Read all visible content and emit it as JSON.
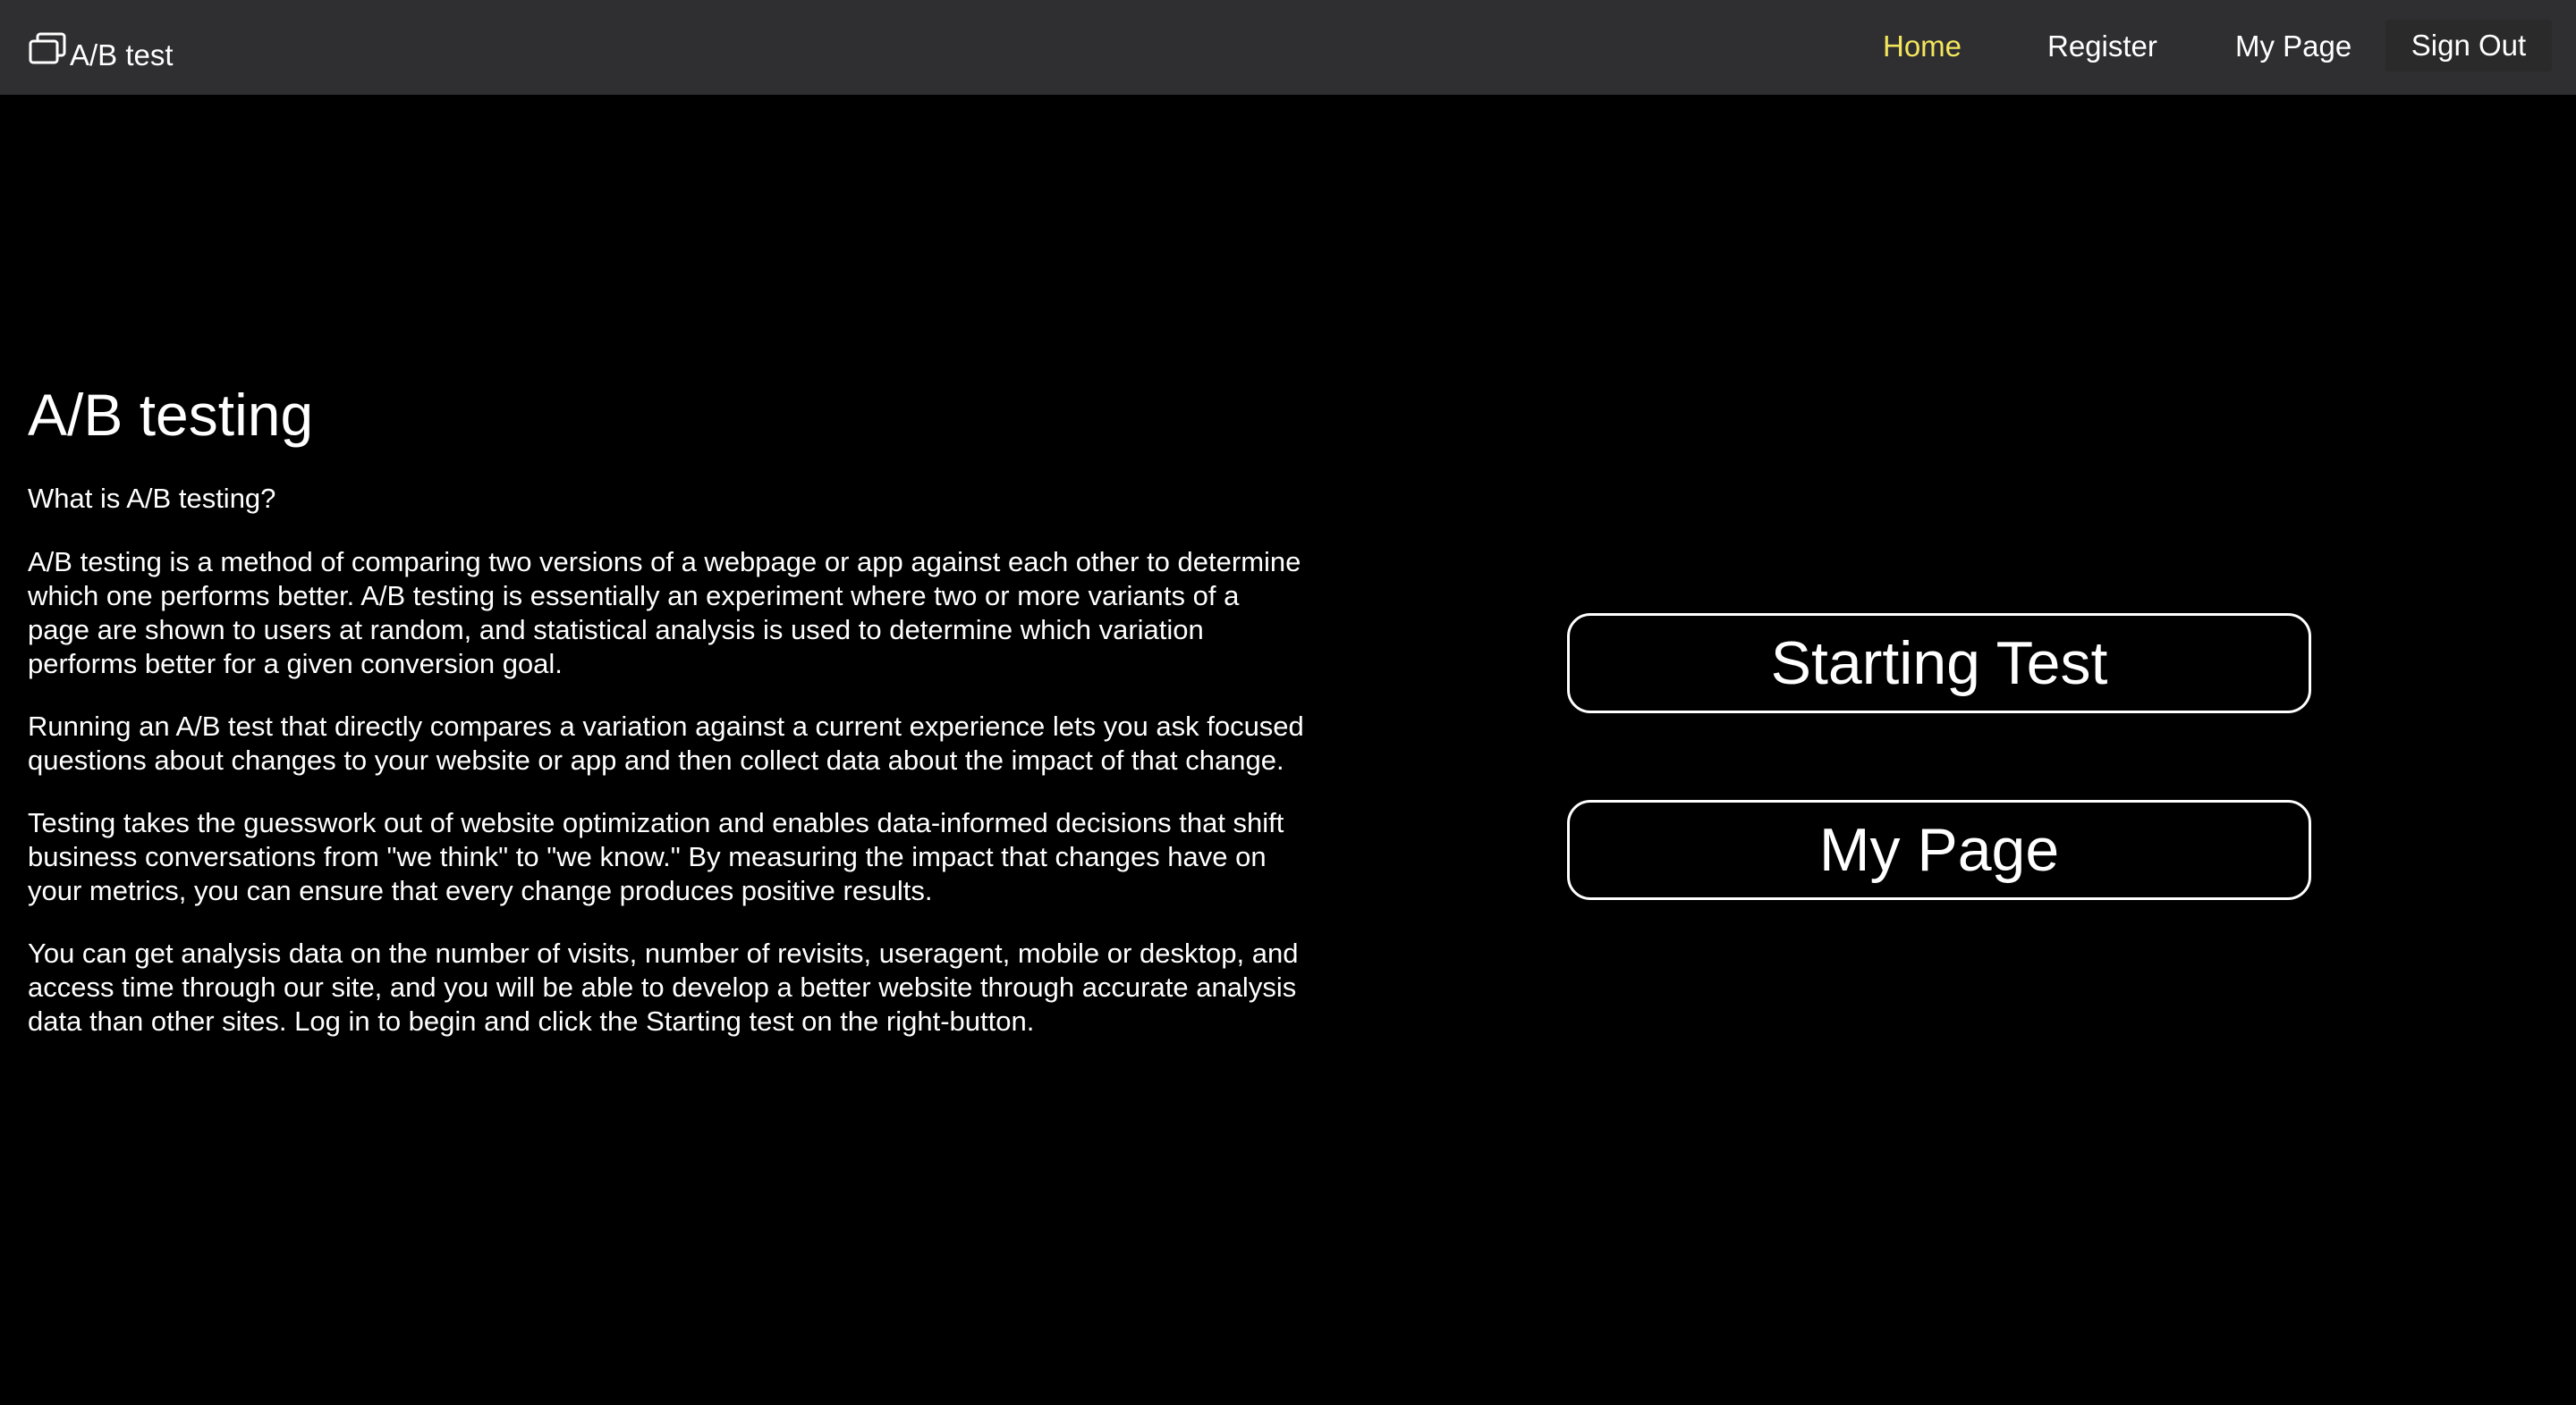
{
  "navbar": {
    "brand": {
      "icon": "window-icon",
      "label": "A/B test"
    },
    "links": {
      "home": "Home",
      "register": "Register",
      "my_page": "My Page",
      "sign_out": "Sign Out"
    },
    "active_color": "#f3e65c",
    "background": "#2f2f32"
  },
  "main": {
    "title": "A/B testing",
    "subtitle": "What is A/B testing?",
    "paragraphs": [
      "A/B testing is a method of comparing two versions of a webpage or app against each other to determine which one performs better. A/B testing is essentially an experiment where two or more variants of a page are shown to users at random, and statistical analysis is used to determine which variation performs better for a given conversion goal.",
      "Running an A/B test that directly compares a variation against a current experience lets you ask focused questions about changes to your website or app and then collect data about the impact of that change.",
      "Testing takes the guesswork out of website optimization and enables data-informed decisions that shift business conversations from \"we think\" to \"we know.\" By measuring the impact that changes have on your metrics, you can ensure that every change produces positive results.",
      "You can get analysis data on the number of visits, number of revisits, useragent, mobile or desktop, and access time through our site, and you will be able to develop a better website through accurate analysis data than other sites. Log in to begin and click the Starting test on the right-button."
    ]
  },
  "actions": {
    "starting_test": "Starting Test",
    "my_page": "My Page"
  }
}
